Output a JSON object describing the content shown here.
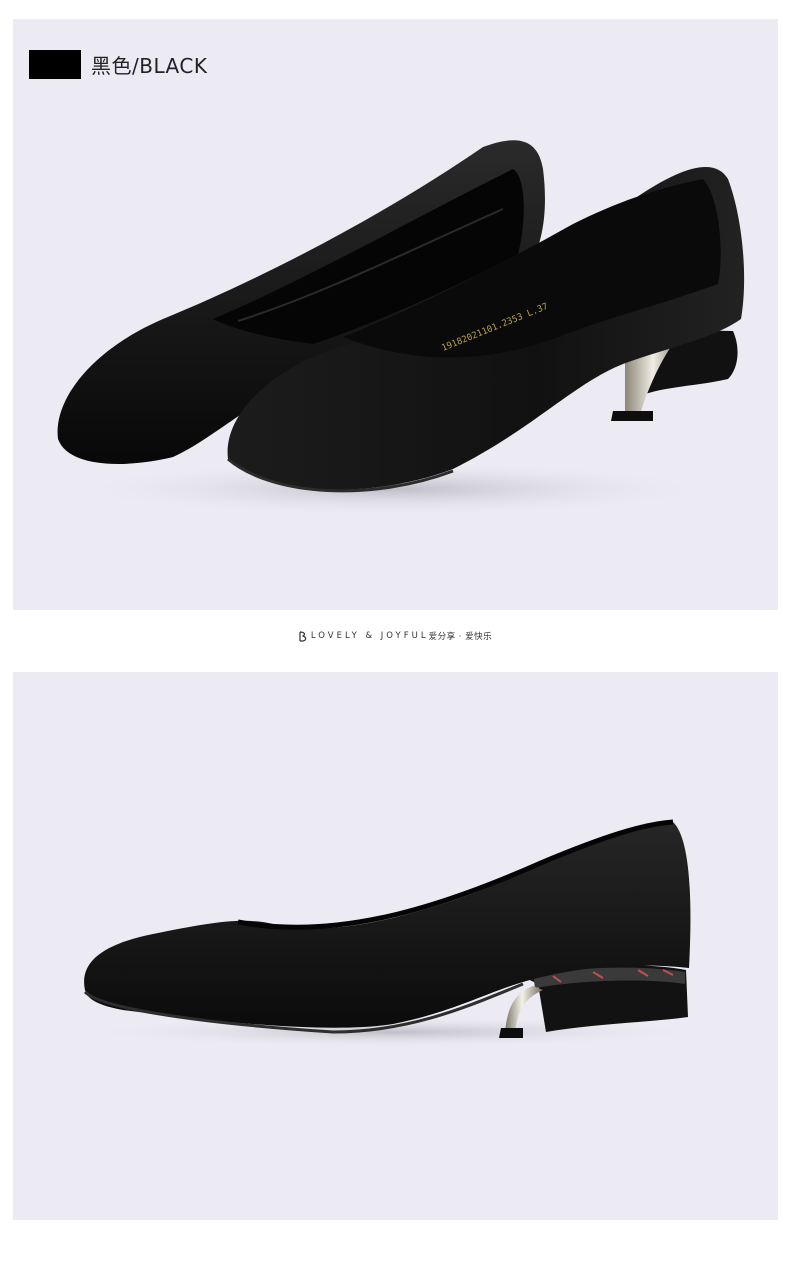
{
  "color_option": {
    "swatch_color": "#000000",
    "label": "黑色/BLACK"
  },
  "divider": {
    "brand_text": "LOVELY & JOYFUL",
    "tagline": "爱分享 · 爱快乐"
  },
  "photos": {
    "top": {
      "subject": "pair of black suede pointed-toe low heel pumps"
    },
    "bottom": {
      "subject": "single black suede pointed-toe pump side view"
    },
    "insole_print": "19182021101.2353 L.37"
  },
  "colors": {
    "panel_bg": "#ecebf3",
    "suede": "#141414",
    "metal_heel": "#c9c3b6"
  }
}
